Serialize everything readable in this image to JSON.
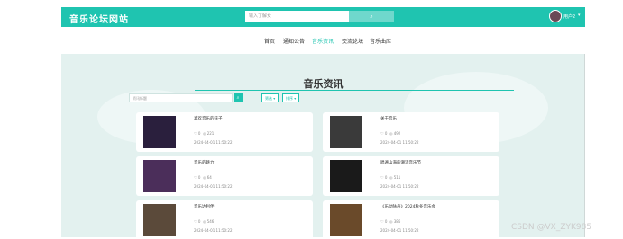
{
  "header": {
    "logo": "音乐论坛网站",
    "search_placeholder": "输入了解女",
    "search_button": "⌕",
    "username": "用户2",
    "chevron": "▾"
  },
  "nav": {
    "items": [
      "首页",
      "通知公告",
      "音乐资讯",
      "交流论坛",
      "音乐曲库"
    ],
    "active": "音乐资讯"
  },
  "main": {
    "title": "音乐资讯",
    "filter_placeholder": "资讯标题",
    "filter_button": "⌕",
    "sort_buttons": [
      "筛选 ▾",
      "排序 ▾"
    ]
  },
  "cards": [
    {
      "title": "喜欢音乐的孩子",
      "likes": "0",
      "views": "221",
      "time": "2024-04-01 11:50:22",
      "img_color": "#2a1f3d"
    },
    {
      "title": "关于音乐",
      "likes": "0",
      "views": "492",
      "time": "2024-04-01 11:50:22",
      "img_color": "#3a3a3a"
    },
    {
      "title": "音乐的魅力",
      "likes": "0",
      "views": "64",
      "time": "2024-04-01 11:50:22",
      "img_color": "#4b2e5a"
    },
    {
      "title": "唱遍山海的潮流音乐节",
      "likes": "0",
      "views": "511",
      "time": "2024-04-01 11:50:22",
      "img_color": "#1a1a1a"
    },
    {
      "title": "音乐达利伴",
      "likes": "0",
      "views": "546",
      "time": "2024-04-01 11:50:22",
      "img_color": "#5b4a3a"
    },
    {
      "title": "《乐动陆舟》2024秋冬音乐会",
      "likes": "0",
      "views": "386",
      "time": "2024-04-01 11:50:22",
      "img_color": "#6a4a2a"
    }
  ],
  "watermark": "CSDN @VX_ZYK985"
}
